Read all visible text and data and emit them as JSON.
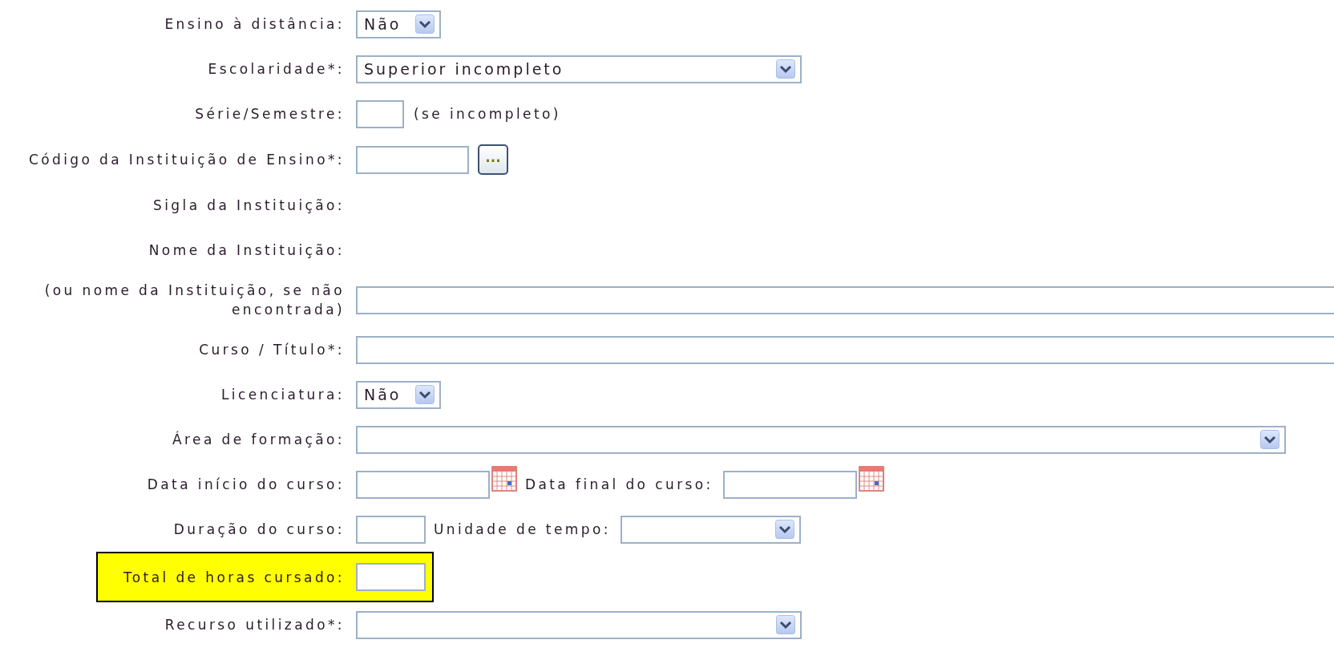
{
  "form": {
    "rows": [
      {
        "label": "Ensino à distância:",
        "highlighted": false,
        "controls": [
          {
            "kind": "select",
            "value": "Não"
          }
        ]
      },
      {
        "label": "Escolaridade*:",
        "highlighted": false,
        "controls": [
          {
            "kind": "select",
            "value": "Superior incompleto"
          }
        ]
      },
      {
        "label": "Série/Semestre:",
        "highlighted": false,
        "controls": [
          {
            "kind": "text"
          },
          {
            "kind": "note",
            "text": "(se incompleto)"
          }
        ]
      },
      {
        "label": "Código da Instituição de Ensino*:",
        "highlighted": false,
        "controls": [
          {
            "kind": "text"
          },
          {
            "kind": "button",
            "text": "..."
          }
        ]
      },
      {
        "label": "Sigla da Instituição:",
        "highlighted": false,
        "controls": []
      },
      {
        "label": "Nome da Instituição:",
        "highlighted": false,
        "controls": []
      },
      {
        "label": "(ou nome da Instituição, se não encontrada)",
        "highlighted": false,
        "controls": [
          {
            "kind": "text"
          }
        ]
      },
      {
        "label": "Curso / Título*:",
        "highlighted": false,
        "controls": [
          {
            "kind": "text"
          }
        ]
      },
      {
        "label": "Licenciatura:",
        "highlighted": false,
        "controls": [
          {
            "kind": "select",
            "value": "Não"
          }
        ]
      },
      {
        "label": "Área de formação:",
        "highlighted": false,
        "controls": [
          {
            "kind": "select"
          }
        ]
      },
      {
        "label": "Data início do curso:",
        "highlighted": false,
        "controls": [
          {
            "kind": "date"
          },
          {
            "kind": "inline-label",
            "text": "Data final do curso:"
          },
          {
            "kind": "date"
          }
        ]
      },
      {
        "label": "Duração do curso:",
        "highlighted": false,
        "controls": [
          {
            "kind": "text"
          },
          {
            "kind": "inline-label",
            "text": "Unidade de tempo:"
          },
          {
            "kind": "select"
          }
        ]
      },
      {
        "label": "Total de horas cursado:",
        "highlighted": true,
        "controls": [
          {
            "kind": "text"
          }
        ]
      },
      {
        "label": "Recurso utilizado*:",
        "highlighted": false,
        "controls": [
          {
            "kind": "select"
          }
        ]
      }
    ]
  }
}
